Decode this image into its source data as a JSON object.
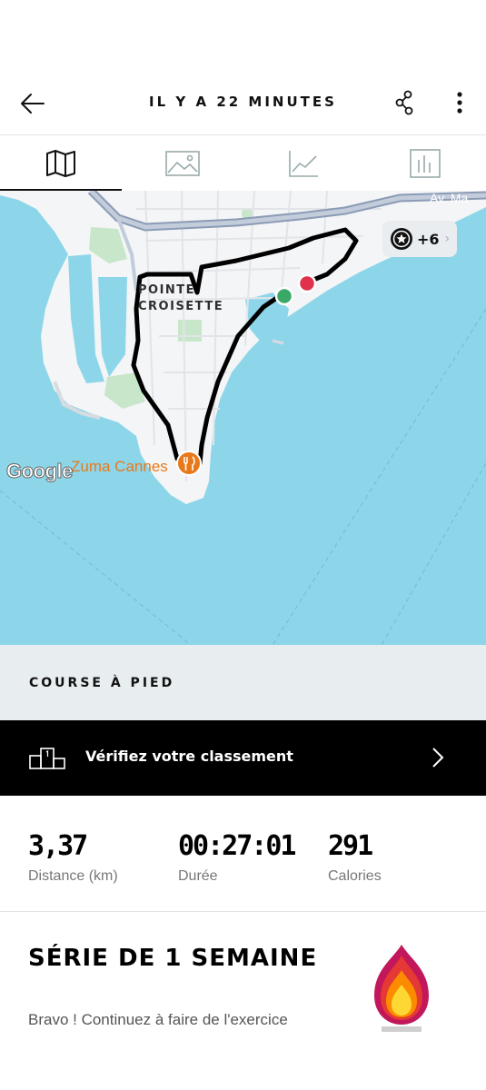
{
  "header": {
    "title": "IL Y A 22 MINUTES"
  },
  "tabs": [
    {
      "icon": "map-icon",
      "active": true
    },
    {
      "icon": "image-icon",
      "active": false
    },
    {
      "icon": "line-chart-icon",
      "active": false
    },
    {
      "icon": "bar-chart-icon",
      "active": false
    }
  ],
  "map": {
    "place_label_line1": "POINTE",
    "place_label_line2": "CROISETTE",
    "poi_label": "Zuma Cannes",
    "street_label": "Av. Ma",
    "attribution": "Google",
    "achievements_badge": "+6",
    "colors": {
      "water": "#8dd6ea",
      "route": "#000000",
      "start_marker": "#3aa867",
      "end_marker": "#e0324b",
      "poi": "#e8791b"
    }
  },
  "activity": {
    "type_label": "COURSE À PIED"
  },
  "ranking": {
    "label": "Vérifiez votre classement"
  },
  "stats": [
    {
      "value": "3,37",
      "label": "Distance (km)"
    },
    {
      "value": "00:27:01",
      "label": "Durée"
    },
    {
      "value": "291",
      "label": "Calories"
    }
  ],
  "streak": {
    "title": "SÉRIE DE 1 SEMAINE",
    "text": "Bravo ! Continuez à faire de l'exercice"
  }
}
